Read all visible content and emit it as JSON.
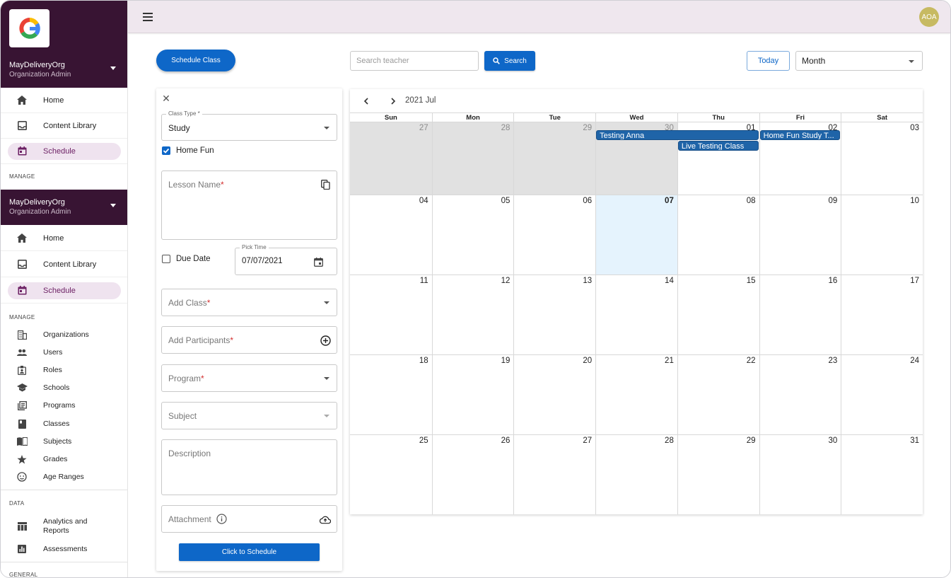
{
  "app": {
    "org_name": "MayDeliveryOrg",
    "org_role": "Organization Admin",
    "avatar_initials": "AOA",
    "brand_color": "#381433",
    "accent_color": "#0e67c8"
  },
  "sidebar": {
    "primary_items": [
      {
        "label": "Home",
        "icon": "home-icon"
      },
      {
        "label": "Content Library",
        "icon": "inbox-icon"
      },
      {
        "label": "Schedule",
        "icon": "calendar-icon",
        "active": true
      }
    ],
    "manage_heading": "MANAGE",
    "manage_items": [
      {
        "label": "Organizations",
        "icon": "building-icon"
      },
      {
        "label": "Users",
        "icon": "people-icon"
      },
      {
        "label": "Roles",
        "icon": "badge-icon"
      },
      {
        "label": "Schools",
        "icon": "school-icon"
      },
      {
        "label": "Programs",
        "icon": "library-icon"
      },
      {
        "label": "Classes",
        "icon": "book-icon"
      },
      {
        "label": "Subjects",
        "icon": "open-book-icon"
      },
      {
        "label": "Grades",
        "icon": "star-icon"
      },
      {
        "label": "Age Ranges",
        "icon": "face-icon"
      }
    ],
    "data_heading": "DATA",
    "data_items": [
      {
        "label": "Analytics and Reports",
        "icon": "table-chart-icon"
      },
      {
        "label": "Assessments",
        "icon": "assessment-icon"
      }
    ],
    "general_heading": "GENERAL"
  },
  "toolbar": {
    "schedule_class_label": "Schedule Class",
    "search_placeholder": "Search teacher",
    "search_label": "Search",
    "today_label": "Today",
    "view_value": "Month"
  },
  "form": {
    "class_type_legend": "Class Type *",
    "class_type_value": "Study",
    "home_fun_label": "Home Fun",
    "home_fun_checked": true,
    "lesson_name_label": "Lesson Name",
    "due_date_label": "Due Date",
    "due_date_checked": false,
    "pick_time_legend": "Pick Time",
    "pick_time_value": "07/07/2021",
    "add_class_label": "Add Class",
    "add_participants_label": "Add Participants",
    "program_label": "Program",
    "subject_label": "Subject",
    "description_label": "Description",
    "attachment_label": "Attachment",
    "required_mark": "*",
    "submit_label": "Click to Schedule"
  },
  "calendar": {
    "month_label": "2021 Jul",
    "weekdays": [
      "Sun",
      "Mon",
      "Tue",
      "Wed",
      "Thu",
      "Fri",
      "Sat"
    ],
    "weeks": [
      [
        "27",
        "28",
        "29",
        "30",
        "01",
        "02",
        "03"
      ],
      [
        "04",
        "05",
        "06",
        "07",
        "08",
        "09",
        "10"
      ],
      [
        "11",
        "12",
        "13",
        "14",
        "15",
        "16",
        "17"
      ],
      [
        "18",
        "19",
        "20",
        "21",
        "22",
        "23",
        "24"
      ],
      [
        "25",
        "26",
        "27",
        "28",
        "29",
        "30",
        "31"
      ]
    ],
    "today": "07",
    "events": [
      {
        "title": "Testing Anna"
      },
      {
        "title": "Live Testing Class"
      },
      {
        "title": "Home Fun Study T..."
      }
    ]
  }
}
